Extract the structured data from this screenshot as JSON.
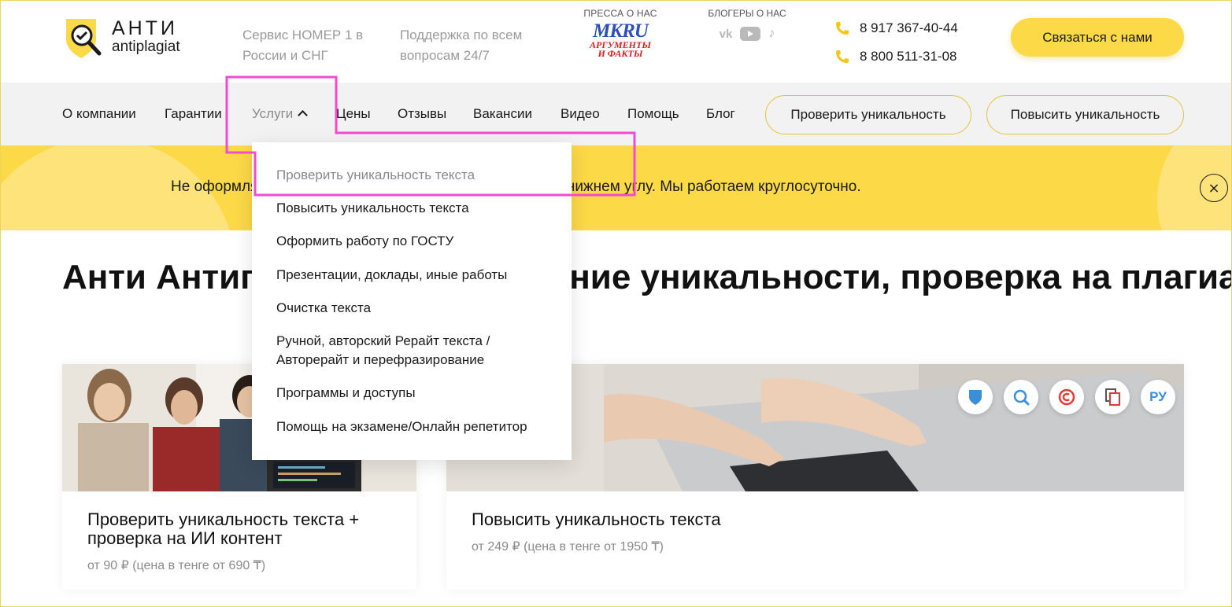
{
  "header": {
    "logo_title": "АНТИ",
    "logo_sub": "antiplagiat",
    "tagline_1": "Сервис НОМЕР 1 в России и СНГ",
    "tagline_2": "Поддержка по всем вопросам 24/7",
    "press_label": "ПРЕССА О НАС",
    "press_logo_1": "MKRU",
    "press_logo_2a": "АРГУМЕНТЫ",
    "press_logo_2b": "И ФАКТЫ",
    "bloggers_label": "БЛОГЕРЫ О НАС",
    "social_icons": [
      "vk-icon",
      "youtube-icon",
      "tiktok-icon"
    ],
    "phone_1": "8 917 367-40-44",
    "phone_2": "8 800 511-31-08",
    "contact_button": "Связаться с нами"
  },
  "nav": {
    "items": [
      {
        "label": "О компании"
      },
      {
        "label": "Гарантии"
      },
      {
        "label": "Услуги"
      },
      {
        "label": "Цены"
      },
      {
        "label": "Отзывы"
      },
      {
        "label": "Вакансии"
      },
      {
        "label": "Видео"
      },
      {
        "label": "Помощь"
      },
      {
        "label": "Блог"
      }
    ],
    "button_check": "Проверить уникальность",
    "button_raise": "Повысить уникальность"
  },
  "dropdown": {
    "items": [
      {
        "label": "Проверить уникальность текста"
      },
      {
        "label": "Повысить уникальность текста"
      },
      {
        "label": "Оформить работу по ГОСТУ"
      },
      {
        "label": "Презентации, доклады, иные работы"
      },
      {
        "label": "Очистка текста"
      },
      {
        "label": "Ручной, авторский Рерайт текста / Авторерайт и перефразирование"
      },
      {
        "label": "Программы и доступы"
      },
      {
        "label": "Помощь на экзамене/Онлайн репетитор"
      }
    ]
  },
  "banner": {
    "text": "Не оформляйте заказ, пока не напишите в чат в правом нижнем углу. Мы работаем круглосуточно.",
    "close_icon": "×"
  },
  "main": {
    "title": "Анти Антиплагиат — повышение уникальности, проверка на плагиат",
    "cards": [
      {
        "title": "Проверить уникальность текста + проверка на ИИ контент",
        "price": "от 90 ₽ (цена в тенге от 690 ₸)"
      },
      {
        "title": "Повысить уникальность текста",
        "price": "от 249 ₽ (цена в тенге от 1950 ₸)"
      }
    ],
    "badge_ru": "РУ"
  },
  "colors": {
    "accent_yellow": "#fcd947",
    "highlight": "#f24bd0",
    "muted_text": "#8a8a8a"
  }
}
